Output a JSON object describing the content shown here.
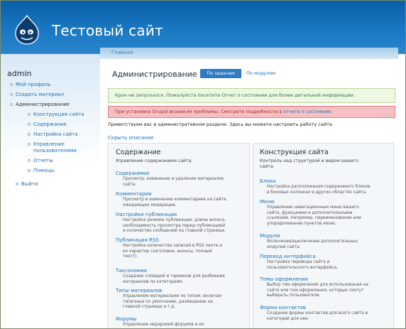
{
  "site": {
    "name": "Тестовый сайт"
  },
  "breadcrumb": "Главная",
  "sidebar": {
    "title": "admin",
    "items": [
      {
        "label": "Мой профиль"
      },
      {
        "label": "Создать материал"
      },
      {
        "label": "Администрирование"
      },
      {
        "label": "Конструкция сайта"
      },
      {
        "label": "Содержание"
      },
      {
        "label": "Настройка сайта"
      },
      {
        "label": "Управление"
      },
      {
        "label": "пользователями"
      },
      {
        "label": "Отчеты"
      },
      {
        "label": "Помощь"
      },
      {
        "label": "Выйти"
      }
    ]
  },
  "main": {
    "title": "Администрирование",
    "tabs": [
      {
        "label": "По задачам"
      },
      {
        "label": "По модулям"
      }
    ],
    "msg_ok": "Крон не запускался. Пожалуйста посетите Отчет о состоянии для более детальной информации.",
    "msg_err_text": "При установке Drupal возникли проблемы. Смотрите подробности в ",
    "msg_err_link": "отчете о состоянии.",
    "welcome": "Приветствуем вас в административном разделе. Здесь вы можете настроить работу сайта.",
    "hide_desc": "Скрыть описание"
  },
  "panel_left": {
    "title": "Содержание",
    "desc": "Управление содержанием сайта.",
    "items": [
      {
        "label": "Содержимое",
        "text": [
          "Просмотр, изменение и удаление материалов",
          "сайта."
        ]
      },
      {
        "label": "Комментарии",
        "text": [
          "Просмотр и изменение комментариев на сайте,",
          "ожидающих модерации."
        ]
      },
      {
        "label": "Настройки публикации",
        "text": [
          "Настройка режима публикации: длина анонса,",
          "необходимость просмотра перед публикацией",
          "и количество сообщений на главной странице."
        ]
      },
      {
        "label": "Публикация RSS",
        "text": [
          "Настройка количества записей в RSS ленте и",
          "их характер (заголовки, анонсы, полный",
          "текст)."
        ]
      },
      {
        "label": "Таксономия",
        "text": [
          "Создание словарей и терминов для разбиения",
          "материалов по категориям."
        ]
      },
      {
        "label": "Типы материалов",
        "text": [
          "Управление материалами по типам, включая",
          "типичные по умолчанию, размещение на",
          "главной странице и т.д."
        ]
      },
      {
        "label": "Форумы",
        "text": [
          "Управление иерархией форумов и их"
        ]
      }
    ]
  },
  "panel_right": {
    "title": "Конструкция сайта",
    "desc": [
      "Контроль над структурой и видом вашего",
      "сайта."
    ],
    "items": [
      {
        "label": "Блоки",
        "text": [
          "Настройка расположения содержимого блоков",
          "в боковых колонках и других областях сайта."
        ]
      },
      {
        "label": "Меню",
        "text": [
          "Управление навигационным меню вашего",
          "сайта, функциями и дополнительными",
          "ссылками. Например, переименование или",
          "упорядочивание пунктов меню."
        ]
      },
      {
        "label": "Модули",
        "text": [
          "Включение/выключение дополнительных",
          "модулей сайта."
        ]
      },
      {
        "label": "Перевод интерфейса",
        "text": [
          "Настройка перевода сайта и",
          "пользовательского интерфейса."
        ]
      },
      {
        "label": "Темы оформления",
        "text": [
          "Выбор тем оформления для использования на",
          "сайте или тем оформления, которые смогут",
          "выбирать пользователи."
        ]
      },
      {
        "label": "Форма контактов",
        "text": [
          "Создание формы контактов для всего сайта и",
          "категорий для нее."
        ]
      }
    ]
  },
  "colors": {
    "header": "#1a78c2",
    "link": "#1e6fb6",
    "tab_active": "#2e7bc4",
    "error_bg": "#f5c0c3",
    "ok_bg": "#eef6e4"
  },
  "icons": {
    "logo": "drupal-drop-icon"
  }
}
